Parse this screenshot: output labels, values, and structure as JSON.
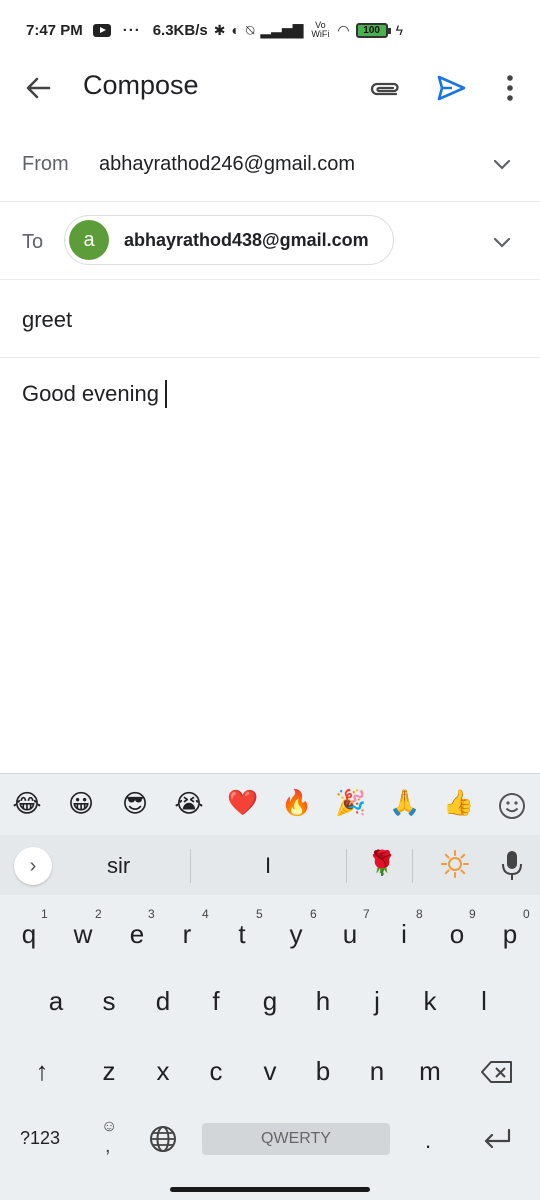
{
  "status_bar": {
    "time": "7:47 PM",
    "dots": "···",
    "network_speed": "6.3KB/s",
    "vowifi": "Vo WiFi",
    "battery": "100"
  },
  "app_bar": {
    "title": "Compose",
    "icons": [
      "back-arrow-icon",
      "attach-icon",
      "send-icon",
      "more-vert-icon"
    ],
    "accent_color": "#1a73e8"
  },
  "compose": {
    "from_label": "From",
    "from_value": "abhayrathod246@gmail.com",
    "to_label": "To",
    "to_chip": {
      "avatar_letter": "a",
      "email": "abhayrathod438@gmail.com",
      "avatar_color": "#5c9d3a"
    },
    "subject": "greet",
    "body": "Good evening"
  },
  "keyboard": {
    "emojis": [
      "😂",
      "😀",
      "😎",
      "😭",
      "❤️",
      "🔥",
      "🎉",
      "🙏",
      "👍"
    ],
    "suggestions": [
      "sir",
      "I",
      "🌹"
    ],
    "rows": {
      "row1": [
        "q",
        "w",
        "e",
        "r",
        "t",
        "y",
        "u",
        "i",
        "o",
        "p"
      ],
      "row1_hints": [
        "1",
        "2",
        "3",
        "4",
        "5",
        "6",
        "7",
        "8",
        "9",
        "0"
      ],
      "row2": [
        "a",
        "s",
        "d",
        "f",
        "g",
        "h",
        "j",
        "k",
        "l"
      ],
      "row3": [
        "z",
        "x",
        "c",
        "v",
        "b",
        "n",
        "m"
      ]
    },
    "symbols_key": "?123",
    "comma_key": ",",
    "period_key": ".",
    "space_label": "QWERTY",
    "shift_key": "↑",
    "enter_key": "↵"
  }
}
